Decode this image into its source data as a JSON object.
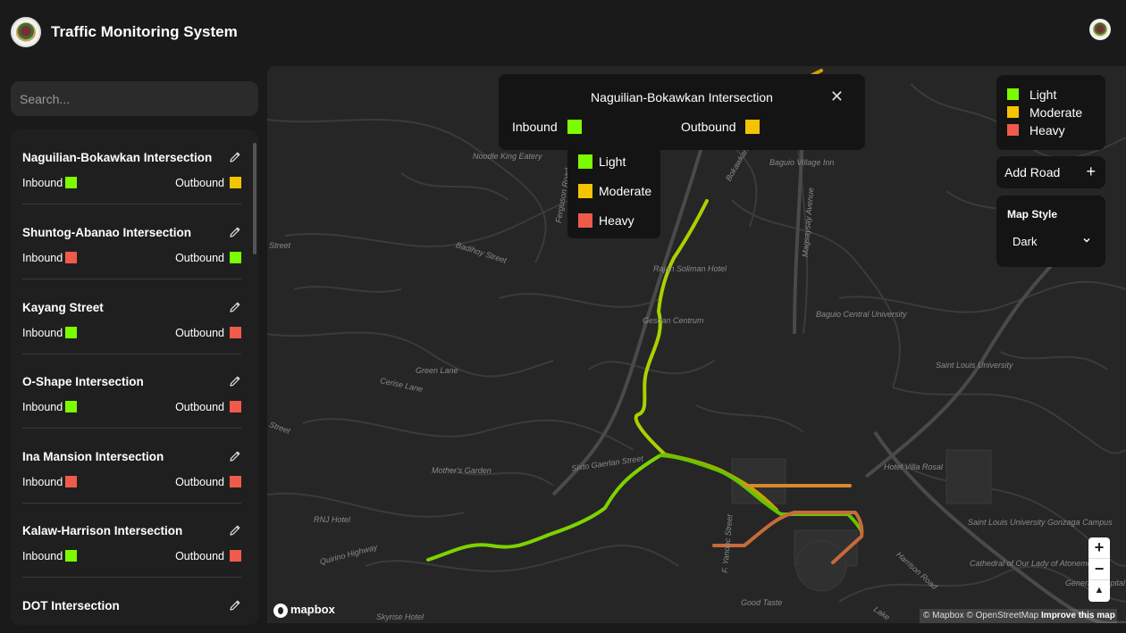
{
  "app": {
    "title": "Traffic Monitoring System"
  },
  "search": {
    "placeholder": "Search..."
  },
  "colors": {
    "light": "#7cfc00",
    "moderate": "#f5c400",
    "heavy": "#f05a4a",
    "background": "#1a1a1a",
    "map": "#262626"
  },
  "labels": {
    "inbound": "Inbound",
    "outbound": "Outbound"
  },
  "intersections": [
    {
      "name": "Naguilian-Bokawkan Intersection",
      "inbound": "light",
      "outbound": "moderate"
    },
    {
      "name": "Shuntog-Abanao Intersection",
      "inbound": "heavy",
      "outbound": "light"
    },
    {
      "name": "Kayang Street",
      "inbound": "light",
      "outbound": "heavy"
    },
    {
      "name": "O-Shape Intersection",
      "inbound": "light",
      "outbound": "heavy"
    },
    {
      "name": "Ina Mansion Intersection",
      "inbound": "heavy",
      "outbound": "heavy"
    },
    {
      "name": "Kalaw-Harrison Intersection",
      "inbound": "light",
      "outbound": "heavy"
    },
    {
      "name": "DOT Intersection",
      "inbound": "",
      "outbound": ""
    }
  ],
  "popup": {
    "title": "Naguilian-Bokawkan Intersection",
    "inbound_label": "Inbound",
    "outbound_label": "Outbound",
    "inbound": "light",
    "outbound": "moderate",
    "close": "✕"
  },
  "popup_dropdown": {
    "options": [
      "Light",
      "Moderate",
      "Heavy"
    ]
  },
  "legend": {
    "items": [
      {
        "label": "Light",
        "level": "light"
      },
      {
        "label": "Moderate",
        "level": "moderate"
      },
      {
        "label": "Heavy",
        "level": "heavy"
      }
    ]
  },
  "add_road": {
    "label": "Add Road",
    "icon": "+"
  },
  "map_style": {
    "label": "Map Style",
    "value": "Dark"
  },
  "zoom": {
    "in": "+",
    "out": "−",
    "compass": "▲"
  },
  "mapbox": {
    "logo": "mapbox",
    "attribution_1": "© Mapbox © OpenStreetMap",
    "attribution_2": "Improve this map"
  },
  "map_labels": [
    "Noodle King Eatery",
    "Baguio Village Inn",
    "Badihoy Street",
    "Rajah Soliman Hotel",
    "Baguio Central University",
    "Gesdan Centrum",
    "Green Lane",
    "Cerise Lane",
    "Saint Louis University",
    "Mother's Garden",
    "Sixto Gaerlan Street",
    "Hotel Villa Rosal",
    "RNJ Hotel",
    "Quirino Highway",
    "Saint Louis University Gonzaga Campus",
    "Cathedral of Our Lady of Atonement",
    "Good Taste",
    "Skyrise Hotel",
    "Harrison Road",
    "F. Yandoc Street",
    "Magsaysay Avenue",
    "Bokawkan",
    "Ferguson Road",
    "Street",
    "Street",
    "General Hospital",
    "Lake"
  ]
}
